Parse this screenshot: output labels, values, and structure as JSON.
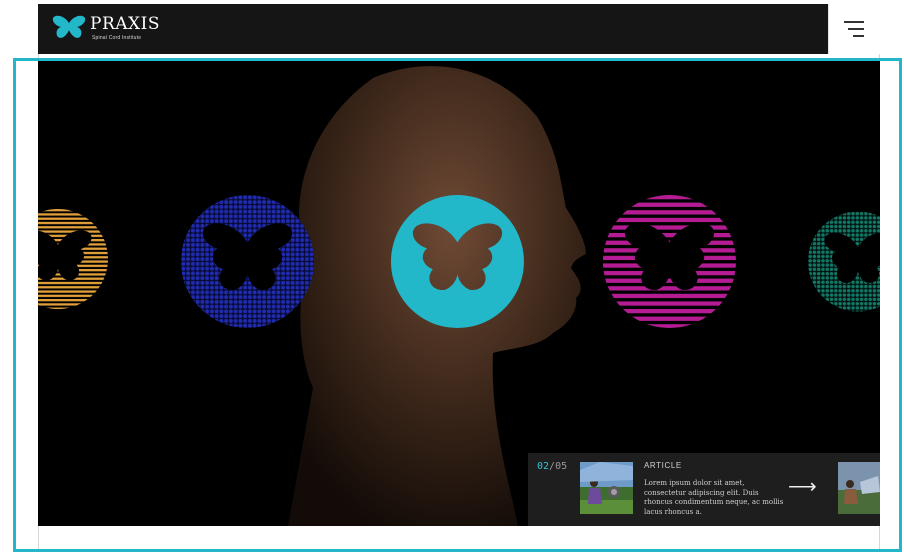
{
  "header": {
    "brand": "PRAXIS",
    "tagline": "Spinal Cord Institute",
    "logo_icon": "butterfly-logo-icon",
    "menu_icon": "hamburger-menu-icon"
  },
  "slider": {
    "current": "02",
    "separator": "/",
    "total": "05",
    "article_label": "ARTICLE",
    "article_text": "Lorem ipsum dolor sit amet, consectetur adipiscing elit. Duis rhoncus condimentum neque, ac mollis lacus rhoncus a.",
    "next_icon": "arrow-right-icon"
  },
  "colors": {
    "accent": "#31c4d5",
    "butterfly_orange": "#e3a03a",
    "butterfly_blue": "#1f2bb0",
    "butterfly_cyan": "#22b7c9",
    "butterfly_magenta": "#b51c93",
    "butterfly_teal": "#127966"
  }
}
